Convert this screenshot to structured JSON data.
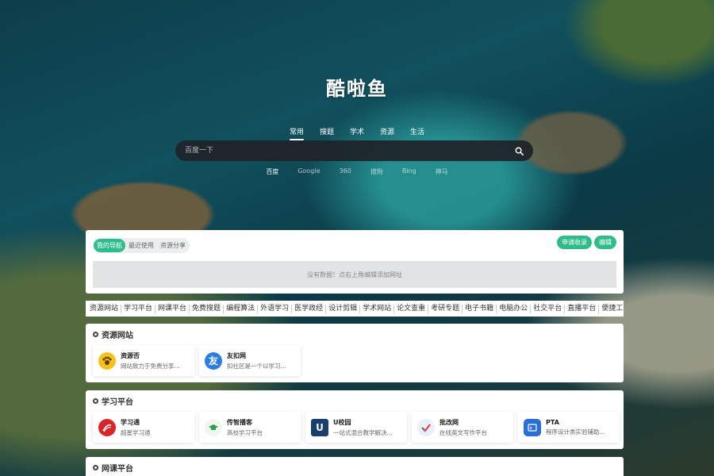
{
  "site": {
    "title": "酷啦鱼"
  },
  "search": {
    "categories": [
      "常用",
      "搜题",
      "学术",
      "资源",
      "生活"
    ],
    "placeholder": "百度一下",
    "engines": [
      "百度",
      "Google",
      "360",
      "搜狗",
      "Bing",
      "神马"
    ]
  },
  "mynav": {
    "tabs": [
      "我的导航",
      "最近使用",
      "资源分享"
    ],
    "apply_label": "申请收录",
    "edit_label": "编辑",
    "empty_text": "没有数据！点右上角编辑添加网址"
  },
  "quicknav": [
    "资源网站",
    "学习平台",
    "网课平台",
    "免费搜题",
    "编程算法",
    "外语学习",
    "医学政经",
    "设计剪辑",
    "学术网站",
    "论文查重",
    "考研专题",
    "电子书籍",
    "电脑办公",
    "社交平台",
    "直播平台",
    "便捷工具"
  ],
  "sections": [
    {
      "title": "资源网站",
      "cards": [
        {
          "name": "资源否",
          "desc": "网站致力于免费分享...",
          "icon": "paw-icon",
          "color": "#e6a817"
        },
        {
          "name": "友扣网",
          "desc": "扣社区是一个以学习...",
          "icon": "you-icon",
          "color": "#2a7de1"
        }
      ]
    },
    {
      "title": "学习平台",
      "cards": [
        {
          "name": "学习通",
          "desc": "超星学习通",
          "icon": "xuexitong-icon",
          "color": "#d9252a"
        },
        {
          "name": "传智播客",
          "desc": "高校学习平台",
          "icon": "graduation-cap-icon",
          "color": "#2e9e4f"
        },
        {
          "name": "U校园",
          "desc": "一站式混合教学解决...",
          "icon": "u-campus-icon",
          "color": "#1a3e6e"
        },
        {
          "name": "批改网",
          "desc": "在线英文写作平台",
          "icon": "check-icon",
          "color": "#3b8be0"
        },
        {
          "name": "PTA",
          "desc": "程序设计类实验辅助...",
          "icon": "pta-icon",
          "color": "#2a6fd6"
        }
      ]
    },
    {
      "title": "网课平台",
      "cards": []
    }
  ]
}
